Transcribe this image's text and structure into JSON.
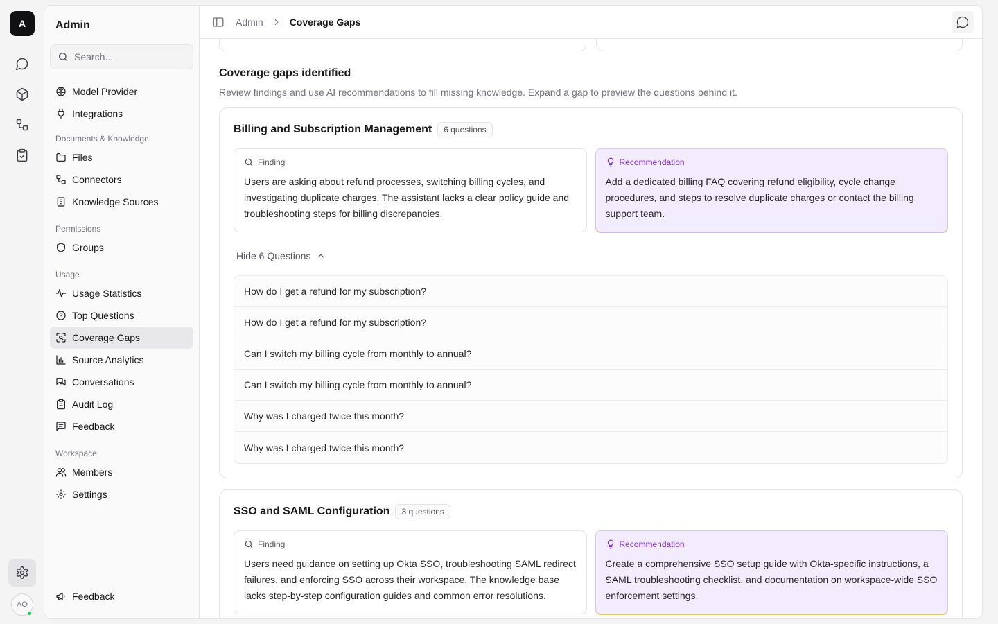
{
  "rail": {
    "logo_letter": "A",
    "top_icons": [
      "chat-bubble-icon",
      "cube-icon",
      "connectors-icon",
      "clipboard-check-icon"
    ],
    "settings_icon": "gear-icon",
    "avatar_initials": "AO",
    "online_color": "#22c55e"
  },
  "sidebar": {
    "title": "Admin",
    "search_placeholder": "Search...",
    "top_items": [
      {
        "label": "Model Provider",
        "icon": "brain-icon"
      },
      {
        "label": "Integrations",
        "icon": "plug-icon"
      }
    ],
    "groups": [
      {
        "title": "Documents & Knowledge",
        "items": [
          {
            "label": "Files",
            "icon": "folder-icon"
          },
          {
            "label": "Connectors",
            "icon": "connectors-icon"
          },
          {
            "label": "Knowledge Sources",
            "icon": "book-icon"
          }
        ]
      },
      {
        "title": "Permissions",
        "items": [
          {
            "label": "Groups",
            "icon": "shield-icon"
          }
        ]
      },
      {
        "title": "Usage",
        "items": [
          {
            "label": "Usage Statistics",
            "icon": "activity-icon"
          },
          {
            "label": "Top Questions",
            "icon": "question-circle-icon"
          },
          {
            "label": "Coverage Gaps",
            "icon": "scan-icon",
            "active": true
          },
          {
            "label": "Source Analytics",
            "icon": "bar-chart-icon"
          },
          {
            "label": "Conversations",
            "icon": "messages-icon"
          },
          {
            "label": "Audit Log",
            "icon": "clipboard-list-icon"
          },
          {
            "label": "Feedback",
            "icon": "message-square-text-icon"
          }
        ]
      },
      {
        "title": "Workspace",
        "items": [
          {
            "label": "Members",
            "icon": "users-icon"
          },
          {
            "label": "Settings",
            "icon": "gear-icon"
          }
        ]
      }
    ],
    "bottom_feedback": "Feedback"
  },
  "topbar": {
    "breadcrumb_parent": "Admin",
    "breadcrumb_current": "Coverage Gaps"
  },
  "main": {
    "section_title": "Coverage gaps identified",
    "section_subtitle": "Review findings and use AI recommendations to fill missing knowledge. Expand a gap to preview the questions behind it.",
    "finding_label": "Finding",
    "recommendation_label": "Recommendation",
    "gaps": [
      {
        "title": "Billing and Subscription Management",
        "count_badge": "6 questions",
        "finding": "Users are asking about refund processes, switching billing cycles, and investigating duplicate charges. The assistant lacks a clear policy guide and troubleshooting steps for billing discrepancies.",
        "recommendation": "Add a dedicated billing FAQ covering refund eligibility, cycle change procedures, and steps to resolve duplicate charges or contact the billing support team.",
        "toggle_label": "Hide 6 Questions",
        "questions": [
          "How do I get a refund for my subscription?",
          "How do I get a refund for my subscription?",
          "Can I switch my billing cycle from monthly to annual?",
          "Can I switch my billing cycle from monthly to annual?",
          "Why was I charged twice this month?",
          "Why was I charged twice this month?"
        ]
      },
      {
        "title": "SSO and SAML Configuration",
        "count_badge": "3 questions",
        "finding": "Users need guidance on setting up Okta SSO, troubleshooting SAML redirect failures, and enforcing SSO across their workspace. The knowledge base lacks step-by-step configuration guides and common error resolutions.",
        "recommendation": "Create a comprehensive SSO setup guide with Okta-specific instructions, a SAML troubleshooting checklist, and documentation on workspace-wide SSO enforcement settings."
      }
    ]
  },
  "colors": {
    "recommendation_bg": "#f3ecfd",
    "recommendation_accent": "#7c2fd6"
  }
}
